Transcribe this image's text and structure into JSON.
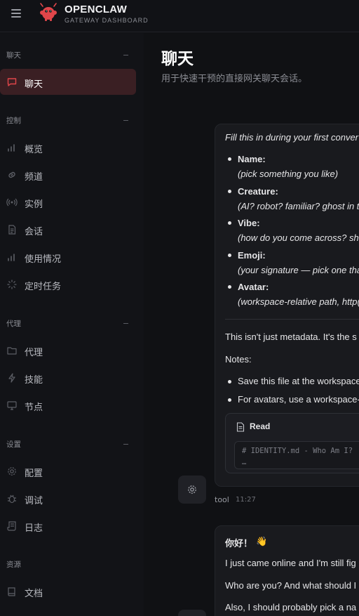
{
  "brand": {
    "name": "OPENCLAW",
    "subtitle": "GATEWAY DASHBOARD"
  },
  "sidebar": {
    "sections": [
      {
        "label": "聊天",
        "items": [
          {
            "label": "聊天",
            "icon": "chat-bubble-icon",
            "active": true
          }
        ]
      },
      {
        "label": "控制",
        "items": [
          {
            "label": "概览",
            "icon": "bar-chart-icon"
          },
          {
            "label": "频道",
            "icon": "link-icon"
          },
          {
            "label": "实例",
            "icon": "broadcast-icon"
          },
          {
            "label": "会话",
            "icon": "document-icon"
          },
          {
            "label": "使用情况",
            "icon": "bar-chart-icon"
          },
          {
            "label": "定时任务",
            "icon": "loader-icon"
          }
        ]
      },
      {
        "label": "代理",
        "items": [
          {
            "label": "代理",
            "icon": "folder-icon"
          },
          {
            "label": "技能",
            "icon": "lightning-icon"
          },
          {
            "label": "节点",
            "icon": "monitor-icon"
          }
        ]
      },
      {
        "label": "设置",
        "items": [
          {
            "label": "配置",
            "icon": "gear-icon"
          },
          {
            "label": "调试",
            "icon": "bug-icon"
          },
          {
            "label": "日志",
            "icon": "scroll-icon"
          }
        ]
      },
      {
        "label": "资源",
        "items": [
          {
            "label": "文档",
            "icon": "book-icon"
          }
        ]
      }
    ]
  },
  "header": {
    "title": "聊天",
    "subtitle": "用于快速干预的直接网关聊天会话。"
  },
  "chat": {
    "message1": {
      "intro": "Fill this in during your first conver",
      "fields": [
        {
          "name": "Name:",
          "hint": "(pick something you like)"
        },
        {
          "name": "Creature:",
          "hint": "(AI? robot? familiar? ghost in t"
        },
        {
          "name": "Vibe:",
          "hint": "(how do you come across? sha"
        },
        {
          "name": "Emoji:",
          "hint": "(your signature — pick one tha"
        },
        {
          "name": "Avatar:",
          "hint": "(workspace-relative path, http("
        }
      ],
      "para": "This isn't just metadata. It's the s",
      "notes_label": "Notes:",
      "notes": [
        "Save this file at the workspace",
        "For avatars, use a workspace-"
      ],
      "tool": {
        "label": "Read",
        "code_line": "# IDENTITY.md - Who Am I?",
        "ellipsis": "…"
      },
      "sender": "tool",
      "time": "11:27"
    },
    "message2": {
      "greeting": "你好！",
      "emoji": "👋",
      "lines": [
        "I just came online and I'm still fig",
        "Who are you? And what should I",
        "Also, I should probably pick a na"
      ]
    }
  },
  "colors": {
    "accent": "#e0464a",
    "active_bg": "#3a1f23",
    "background": "#101114"
  }
}
